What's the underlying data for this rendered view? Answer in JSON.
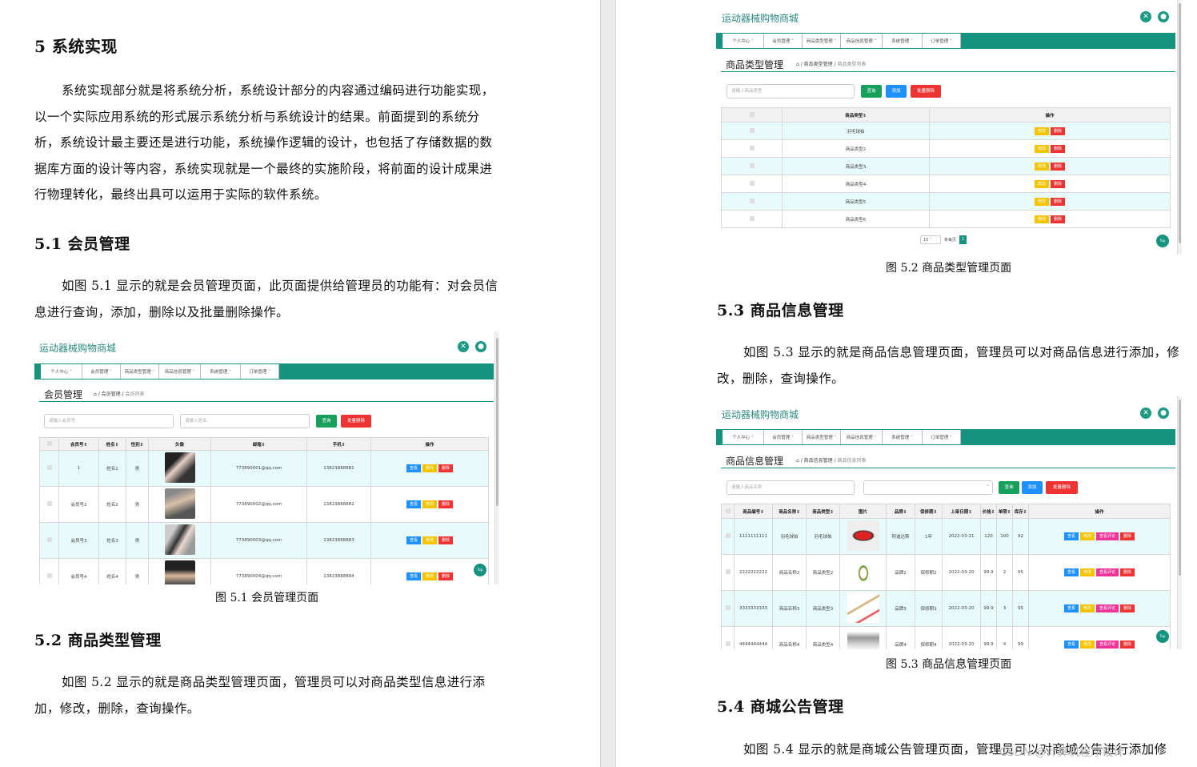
{
  "left_page": {
    "h5": "5  系统实现",
    "intro": "系统实现部分就是将系统分析，系统设计部分的内容通过编码进行功能实现，以一个实际应用系统的形式展示系统分析与系统设计的结果。前面提到的系统分析，系统设计最主要还是进行功能，系统操作逻辑的设计，也包括了存储数据的数据库方面的设计等内容，系统实现就是一个最终的实施阶段，将前面的设计成果进行物理转化，最终出具可以运用于实际的软件系统。",
    "h51": "5.1  会员管理",
    "p51": "如图 5.1 显示的就是会员管理页面，此页面提供给管理员的功能有：对会员信息进行查询，添加，删除以及批量删除操作。",
    "cap51": "图 5.1  会员管理页面",
    "h52": "5.2  商品类型管理",
    "p52": "如图 5.2 显示的就是商品类型管理页面，管理员可以对商品类型信息进行添加，修改，删除，查询操作。"
  },
  "right_page": {
    "cap52": "图 5.2  商品类型管理页面",
    "h53": "5.3  商品信息管理",
    "p53": "如图 5.3 显示的就是商品信息管理页面，管理员可以对商品信息进行添加，修改，删除，查询操作。",
    "cap53": "图 5.3  商品信息管理页面",
    "h54": "5.4  商城公告管理",
    "p54": "如图 5.4 显示的就是商城公告管理页面，管理员可以对商城公告进行添加修",
    "watermark": "CSDN @计算机程序设计"
  },
  "app": {
    "brand": "运动器械购物商城",
    "nav": [
      "个人中心 ˅",
      "会员管理 ˅",
      "商品类型管理 ˅",
      "商品信息管理 ˅",
      "系统管理 ˅",
      "订单管理 ˅"
    ],
    "btn_query": "查询",
    "btn_add": "添加",
    "btn_batch_delete": "批量删除",
    "btn_view": "查看",
    "btn_edit": "修改",
    "btn_delete": "删除",
    "btn_review": "查看评论",
    "top": "Top"
  },
  "fig1": {
    "title": "会员管理",
    "crumb_home": "⌂ / 会员管理 / ",
    "crumb_last": "会员列表",
    "ph1": "请输入会员号",
    "ph2": "请输入姓名",
    "headers": [
      "会员号⇕",
      "姓名⇕",
      "性别⇕",
      "头像",
      "邮箱⇕",
      "手机⇕",
      "操作"
    ],
    "rows": [
      {
        "id": "1",
        "name": "姓名1",
        "sex": "男",
        "email": "773890001@qq.com",
        "phone": "13823888881"
      },
      {
        "id": "会员号2",
        "name": "姓名2",
        "sex": "男",
        "email": "773890002@qq.com",
        "phone": "13823888882"
      },
      {
        "id": "会员号3",
        "name": "姓名3",
        "sex": "男",
        "email": "773890003@qq.com",
        "phone": "13823888883"
      },
      {
        "id": "会员号4",
        "name": "姓名4",
        "sex": "男",
        "email": "773890004@qq.com",
        "phone": "13823888884"
      }
    ]
  },
  "fig2": {
    "title": "商品类型管理",
    "crumb_home": "⌂ / 商品类型管理 / ",
    "crumb_last": "商品类型列表",
    "ph": "请输入商品类型",
    "headers": [
      "商品类型⇕",
      "操作"
    ],
    "rows": [
      "羽毛球拍",
      "商品类型2",
      "商品类型3",
      "商品类型4",
      "商品类型5",
      "商品类型6"
    ],
    "page_size": "10",
    "per_page": "条每页",
    "page": "1"
  },
  "fig3": {
    "title": "商品信息管理",
    "crumb_home": "⌂ / 商品信息管理 / ",
    "crumb_last": "商品信息列表",
    "ph": "请输入商品名称",
    "headers": [
      "商品编号⇕",
      "商品名称⇕",
      "商品类型⇕",
      "图片",
      "品牌⇕",
      "保修期⇕",
      "上架日期⇕",
      "价格⇕",
      "单限⇕",
      "库存⇕",
      "操作"
    ],
    "rows": [
      {
        "no": "1111111111",
        "name": "羽毛球拍",
        "type": "羽毛球拍",
        "brand": "阿迪达斯",
        "warranty": "1年",
        "date": "2022-03-21",
        "price": "120",
        "limit": "100",
        "stock": "92"
      },
      {
        "no": "2222222222",
        "name": "商品名称2",
        "type": "商品类型2",
        "brand": "品牌2",
        "warranty": "保修期2",
        "date": "2022-03-20",
        "price": "99.9",
        "limit": "2",
        "stock": "95"
      },
      {
        "no": "3333333333",
        "name": "商品名称3",
        "type": "商品类型3",
        "brand": "品牌3",
        "warranty": "保修期3",
        "date": "2022-03-20",
        "price": "99.9",
        "limit": "3",
        "stock": "95"
      },
      {
        "no": "4444444444",
        "name": "商品名称4",
        "type": "商品类型4",
        "brand": "品牌4",
        "warranty": "保修期4",
        "date": "2022-03-20",
        "price": "99.9",
        "limit": "4",
        "stock": "99"
      }
    ]
  }
}
